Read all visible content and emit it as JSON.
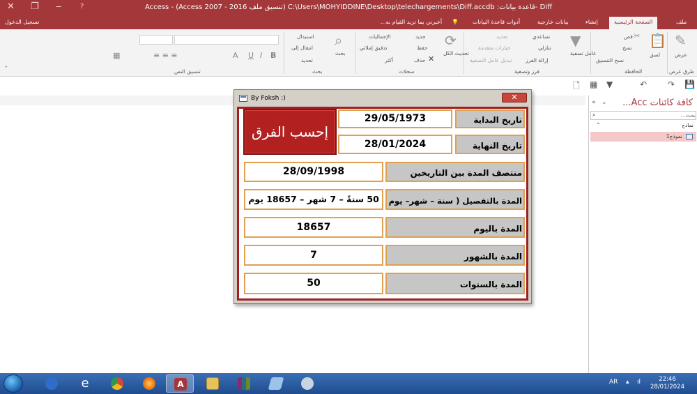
{
  "window": {
    "title": "Access - (Access 2007 - 2016 تنسيق ملف) C:\\Users\\MOHYIDDINE\\Desktop\\telechargements\\Diff.accdb :قاعدة بيانات- Diff",
    "help_icon": "?",
    "close_glyph": "✕",
    "restore_glyph": "❐",
    "minimize_glyph": "‒"
  },
  "tabs": {
    "file": "ملف",
    "home": "الصفحة الرئيسية",
    "create": "إنشاء",
    "external": "بيانات خارجية",
    "dbtools": "أدوات قاعدة البيانات",
    "tell_me": "أخبرني بما تريد القيام به...",
    "signin": "تسجيل الدخول"
  },
  "ribbon": {
    "view": {
      "label": "عرض",
      "group": "طرق عرض"
    },
    "clipboard": {
      "paste": "لصق",
      "cut": "قص",
      "copy": "نسخ",
      "format_painter": "نسخ التنسيق",
      "group": "الحافظة"
    },
    "sort_filter": {
      "filter": "عامل تصفية",
      "ascending": "تصاعدي",
      "descending": "تنازلي",
      "remove_sort": "إزالة الفرز",
      "selection": "تحديد",
      "advanced": "خيارات متقدمة",
      "toggle_filter": "تبديل عامل التصفية",
      "group": "فرز وتصفية"
    },
    "records": {
      "refresh_all": "تحديث الكل",
      "new": "جديد",
      "save": "حفظ",
      "delete": "حذف",
      "totals": "الإجماليات",
      "spelling": "تدقيق إملائي",
      "more": "أكثر",
      "group": "سجلات"
    },
    "find": {
      "find": "بحث",
      "replace": "استبدال",
      "goto": "انتقال إلى",
      "select": "تحديد",
      "group": "بحث"
    },
    "text_format": {
      "group": "تنسيق النص",
      "bold": "B",
      "italic": "I",
      "underline": "U",
      "font_color": "A"
    }
  },
  "nav_pane": {
    "title": "كافة كائنات Acc...",
    "collapse_glyph": "«",
    "search_placeholder": "بحث...",
    "category": "نماذج",
    "item": "نموذج1"
  },
  "form": {
    "title": "By Foksh :)",
    "close_glyph": "✕",
    "calc_button": "إحسب الفرق",
    "start_label": "تاريخ البداية",
    "start_value": "29/05/1973",
    "end_label": "تاريخ النهاية",
    "end_value": "28/01/2024",
    "mid_label": "منتصف المدة بين التاريخين",
    "mid_value": "28/09/1998",
    "detail_label": "المدة بالتفصيل ( سنة – شهر– يوم )",
    "detail_value": "50 سنةً – 7 شهر – 18657 يوم",
    "days_label": "المدة باليوم",
    "days_value": "18657",
    "months_label": "المدة بالشهور",
    "months_value": "7",
    "years_label": "المدة بالسنوات",
    "years_value": "50"
  },
  "taskbar": {
    "language": "AR",
    "time": "22:46",
    "date": "28/01/2024",
    "colors": {
      "ie": "#1a78d0",
      "chrome": "#e8b020",
      "firefox": "#e86a1a",
      "access": "#a4373a",
      "explorer": "#e6c35a",
      "winrar": "#8a2a6a"
    }
  }
}
